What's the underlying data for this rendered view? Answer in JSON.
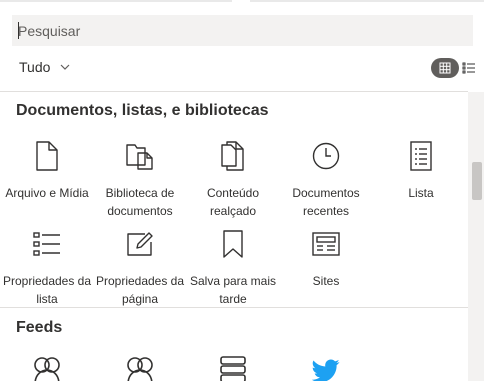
{
  "search": {
    "placeholder": "Pesquisar"
  },
  "filter": {
    "label": "Tudo"
  },
  "view_toggle": {
    "active": "grid"
  },
  "sections": [
    {
      "title": "Documentos, listas, e bibliotecas",
      "items": [
        {
          "label": "Arquivo e Mídia",
          "icon": "document-icon"
        },
        {
          "label": "Biblioteca de documentos",
          "icon": "document-library-icon"
        },
        {
          "label": "Conteúdo realçado",
          "icon": "highlighted-content-icon"
        },
        {
          "label": "Documentos recentes",
          "icon": "clock-icon"
        },
        {
          "label": "Lista",
          "icon": "list-icon"
        },
        {
          "label": "Propriedades da lista",
          "icon": "list-properties-icon"
        },
        {
          "label": "Propriedades da página",
          "icon": "edit-page-icon"
        },
        {
          "label": "Salva para mais tarde",
          "icon": "bookmark-icon"
        },
        {
          "label": "Sites",
          "icon": "sites-icon"
        }
      ]
    },
    {
      "title": "Feeds",
      "items": [
        {
          "label": "",
          "icon": "group-icon"
        },
        {
          "label": "",
          "icon": "group-icon"
        },
        {
          "label": "",
          "icon": "stack-icon"
        },
        {
          "label": "",
          "icon": "twitter-icon"
        }
      ]
    }
  ],
  "colors": {
    "accent_twitter": "#1da1f2",
    "toggle_active": "#605e5c"
  }
}
